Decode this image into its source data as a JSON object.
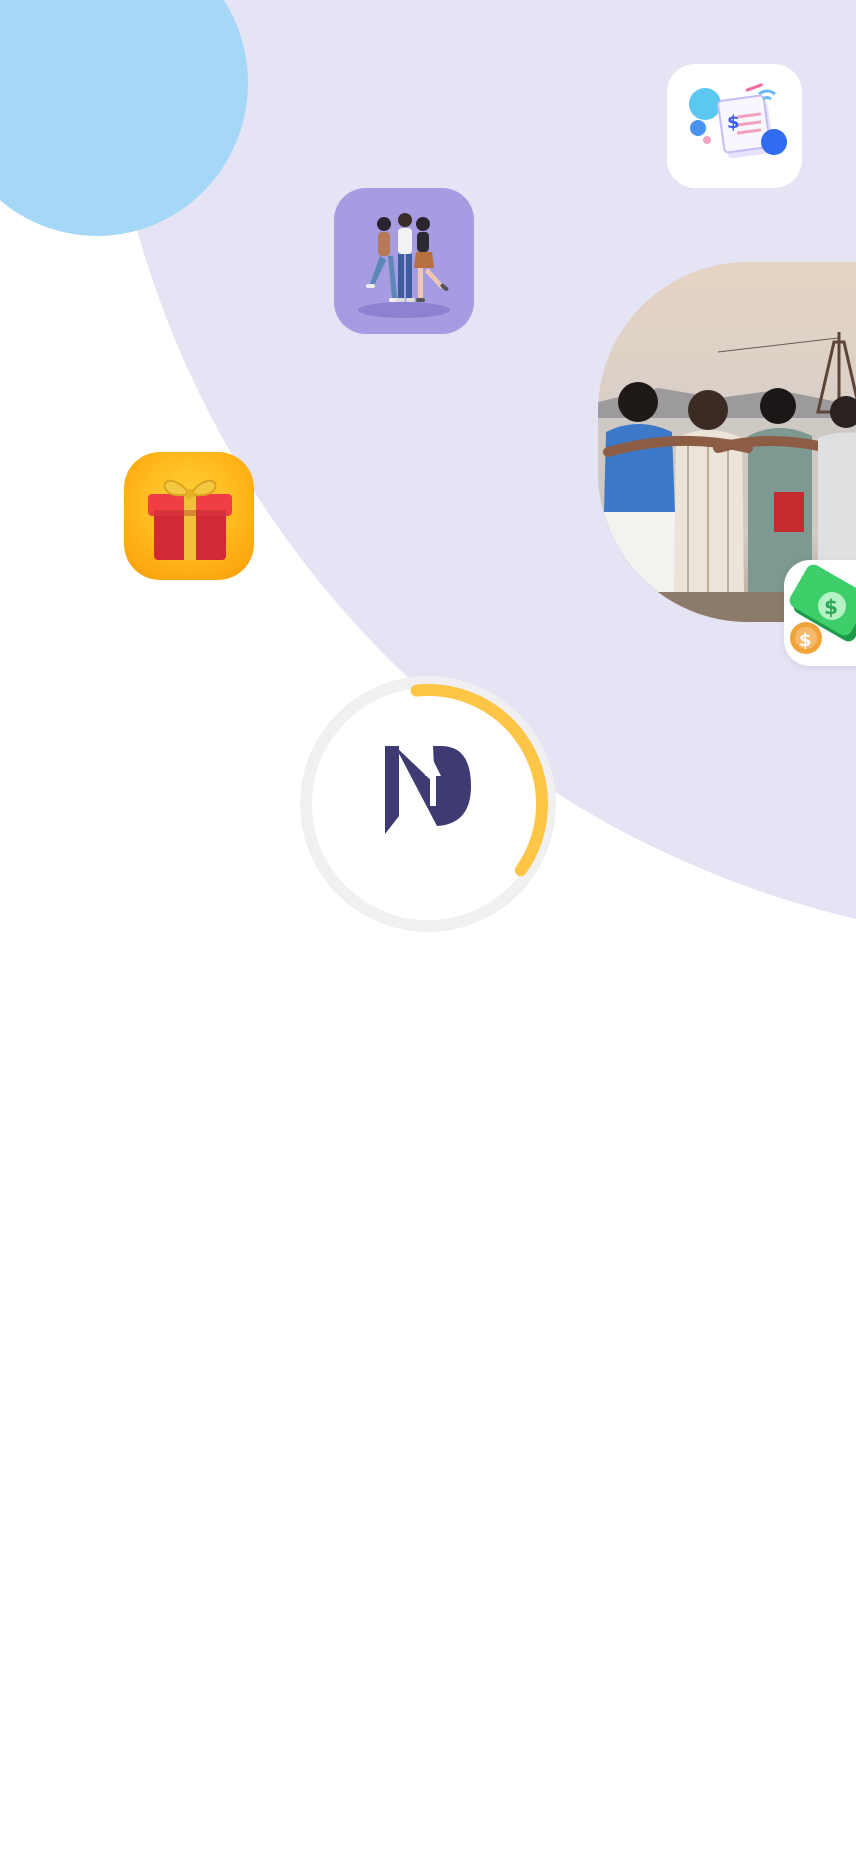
{
  "splash": {
    "logo_icon": "pn-brand-logo",
    "loading_progress": 0.27,
    "colors": {
      "background_blob": "#e5e4f5",
      "sky_circle": "#a5d8f6",
      "logo": "#3e3a72",
      "progress_arc": "#ffc547",
      "progress_track": "#f0f0f2"
    }
  },
  "tiles": [
    {
      "icon": "bill-receipt-icon"
    },
    {
      "icon": "friends-group-icon"
    },
    {
      "icon": "gift-box-icon"
    },
    {
      "icon": "cash-money-icon"
    }
  ],
  "photo": {
    "subject": "friends-by-the-sea-photo"
  }
}
